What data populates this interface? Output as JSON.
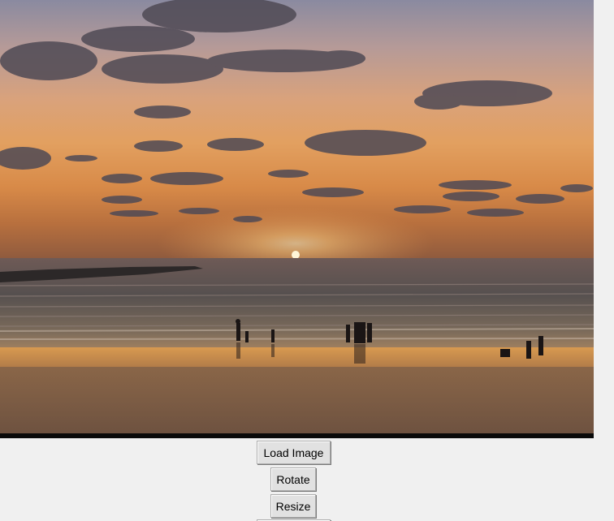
{
  "photo": {
    "subject": "sunset-beach-photo"
  },
  "buttons": {
    "load_image": "Load Image",
    "rotate": "Rotate",
    "resize": "Resize"
  },
  "colors": {
    "window_bg": "#f0f0f0",
    "button_bg": "#e1e1e1",
    "button_border": "#adadad"
  }
}
